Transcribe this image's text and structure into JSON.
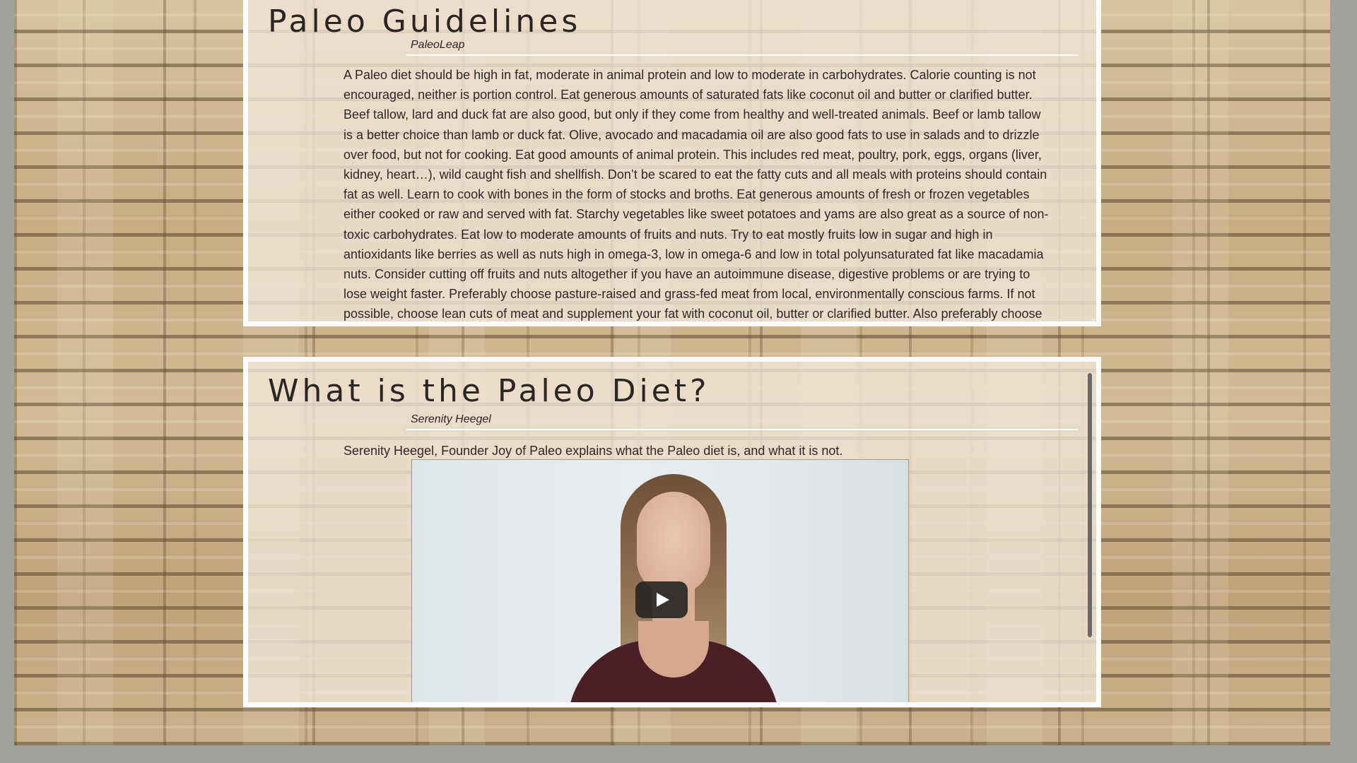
{
  "articles": [
    {
      "title": "Paleo Guidelines",
      "author": "PaleoLeap",
      "lines": [
        "A Paleo diet should be high in fat, moderate in animal protein and low to moderate in carbohydrates. Calorie counting is not",
        "encouraged, neither is portion control. Eat generous amounts of saturated fats like coconut oil and butter or clarified butter.",
        "Beef tallow, lard and duck fat are also good, but only if they come from healthy and well-treated animals. Beef or lamb tallow",
        "is a better choice than lamb or duck fat. Olive, avocado and macadamia oil are also good fats to use in salads and to drizzle",
        "over food, but not for cooking. Eat good amounts of animal protein. This includes red meat, poultry, pork, eggs, organs (liver,",
        "kidney, heart…), wild caught fish and shellfish. Don’t be scared to eat the fatty cuts and all meals with proteins should contain",
        "fat as well. Learn to cook with bones in the form of stocks and broths. Eat generous amounts of fresh or frozen vegetables",
        "either cooked or raw and served with fat. Starchy vegetables like sweet potatoes and yams are also great as a source of non-",
        "toxic carbohydrates. Eat low to moderate amounts of fruits and nuts. Try to eat mostly fruits low in sugar and high in",
        "antioxidants like berries as well as nuts high in omega-3, low in omega-6 and low in total polyunsaturated fat like macadamia",
        "nuts. Consider cutting off fruits and nuts altogether if you have an autoimmune disease, digestive problems or are trying to",
        "lose weight faster. Preferably choose pasture-raised and grass-fed meat from local, environmentally conscious farms. If not",
        "possible, choose lean cuts of meat and supplement your fat with coconut oil, butter or clarified butter. Also preferably choose"
      ]
    },
    {
      "title": "What is the Paleo Diet?",
      "author": "Serenity Heegel",
      "description": "Serenity Heegel, Founder Joy of Paleo explains what the Paleo diet is, and what it is not."
    }
  ],
  "video": {
    "play_icon": "play-icon",
    "scroll_position": 0.0
  },
  "colors": {
    "panel_border": "#ffffff",
    "panel_fill": "#efe5d4",
    "text": "#2a2622",
    "page_bg": "#a3a19e",
    "play_button": "#212121"
  }
}
